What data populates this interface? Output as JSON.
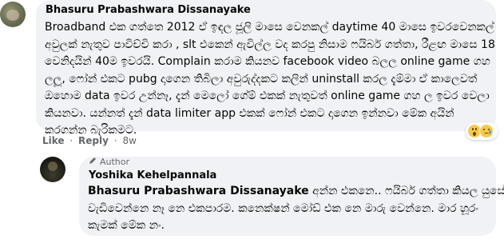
{
  "comment": {
    "author": "Bhasuru Prabashwara Dissanayake",
    "lines": [
      "Broadband එක ගත්තෙ 2012 ඒ ඉඳල ජූලි මාසෙ වෙනකල් daytime 40 මාසෙ ඉවරවෙනකල්",
      "අවුලක් නැතුව පාවිච්චි කරා , slt එකෙන් ඇවිල්ල වද කරපු නිසාම ෆයිබර් ගත්තා, රීළඟ මාසෙ 18",
      "වෙනිදයින් 40ම ඉවරයි. Complain කරාම කියනව facebook video බලල online game ගහ",
      "ලලූ, ෆෝන් එකට pubg දාගෙන තිබිලා අවුරුද්දකට කලින් uninstall කරල දැම්මා ඒ කාලෙවත්",
      "ඔහොම data ඉවර උන්නෑ, දැන් මෙලෝ ගේම් එකක් නැතුවත් online game ගහ ල ඉවර වෙලා",
      "කියනවා. යන්නත් දැන් data limiter app එකක් ෆෝන් එකට දාගෙන ඉන්නවා මේක අයින්",
      "කරගන්න බැරිකමට."
    ],
    "actions": {
      "like": "Like",
      "reply": "Reply",
      "time": "8w",
      "separator": "·"
    }
  },
  "reply": {
    "badge": "Author",
    "author": "Yoshika Kehelpannala",
    "tag": "Bhasuru Prabashwara Dissanayake",
    "lines_first_rest": " අන්න එකනෙ.. ෆයිබර් ගත්තා කියල යුසේජ්",
    "lines": [
      "වැඩිවෙන්නෙ නෑ නෙ එකපාරම. කනෙක්ෂන් මෝඩ් එක නෙ මාරු වෙන්නෙ. මාර හූරං",
      "කැමක් මේක නං."
    ]
  },
  "icons": {
    "avatar_commenter": "avatar-icon",
    "avatar_author": "avatar-icon",
    "author_badge": "pen-icon",
    "reaction_wow": "wow-emoji-icon",
    "reaction_sad": "sad-emoji-icon"
  },
  "colors": {
    "bubble": "#f0f2f5",
    "meta_text": "#65676b",
    "text": "#050505"
  }
}
